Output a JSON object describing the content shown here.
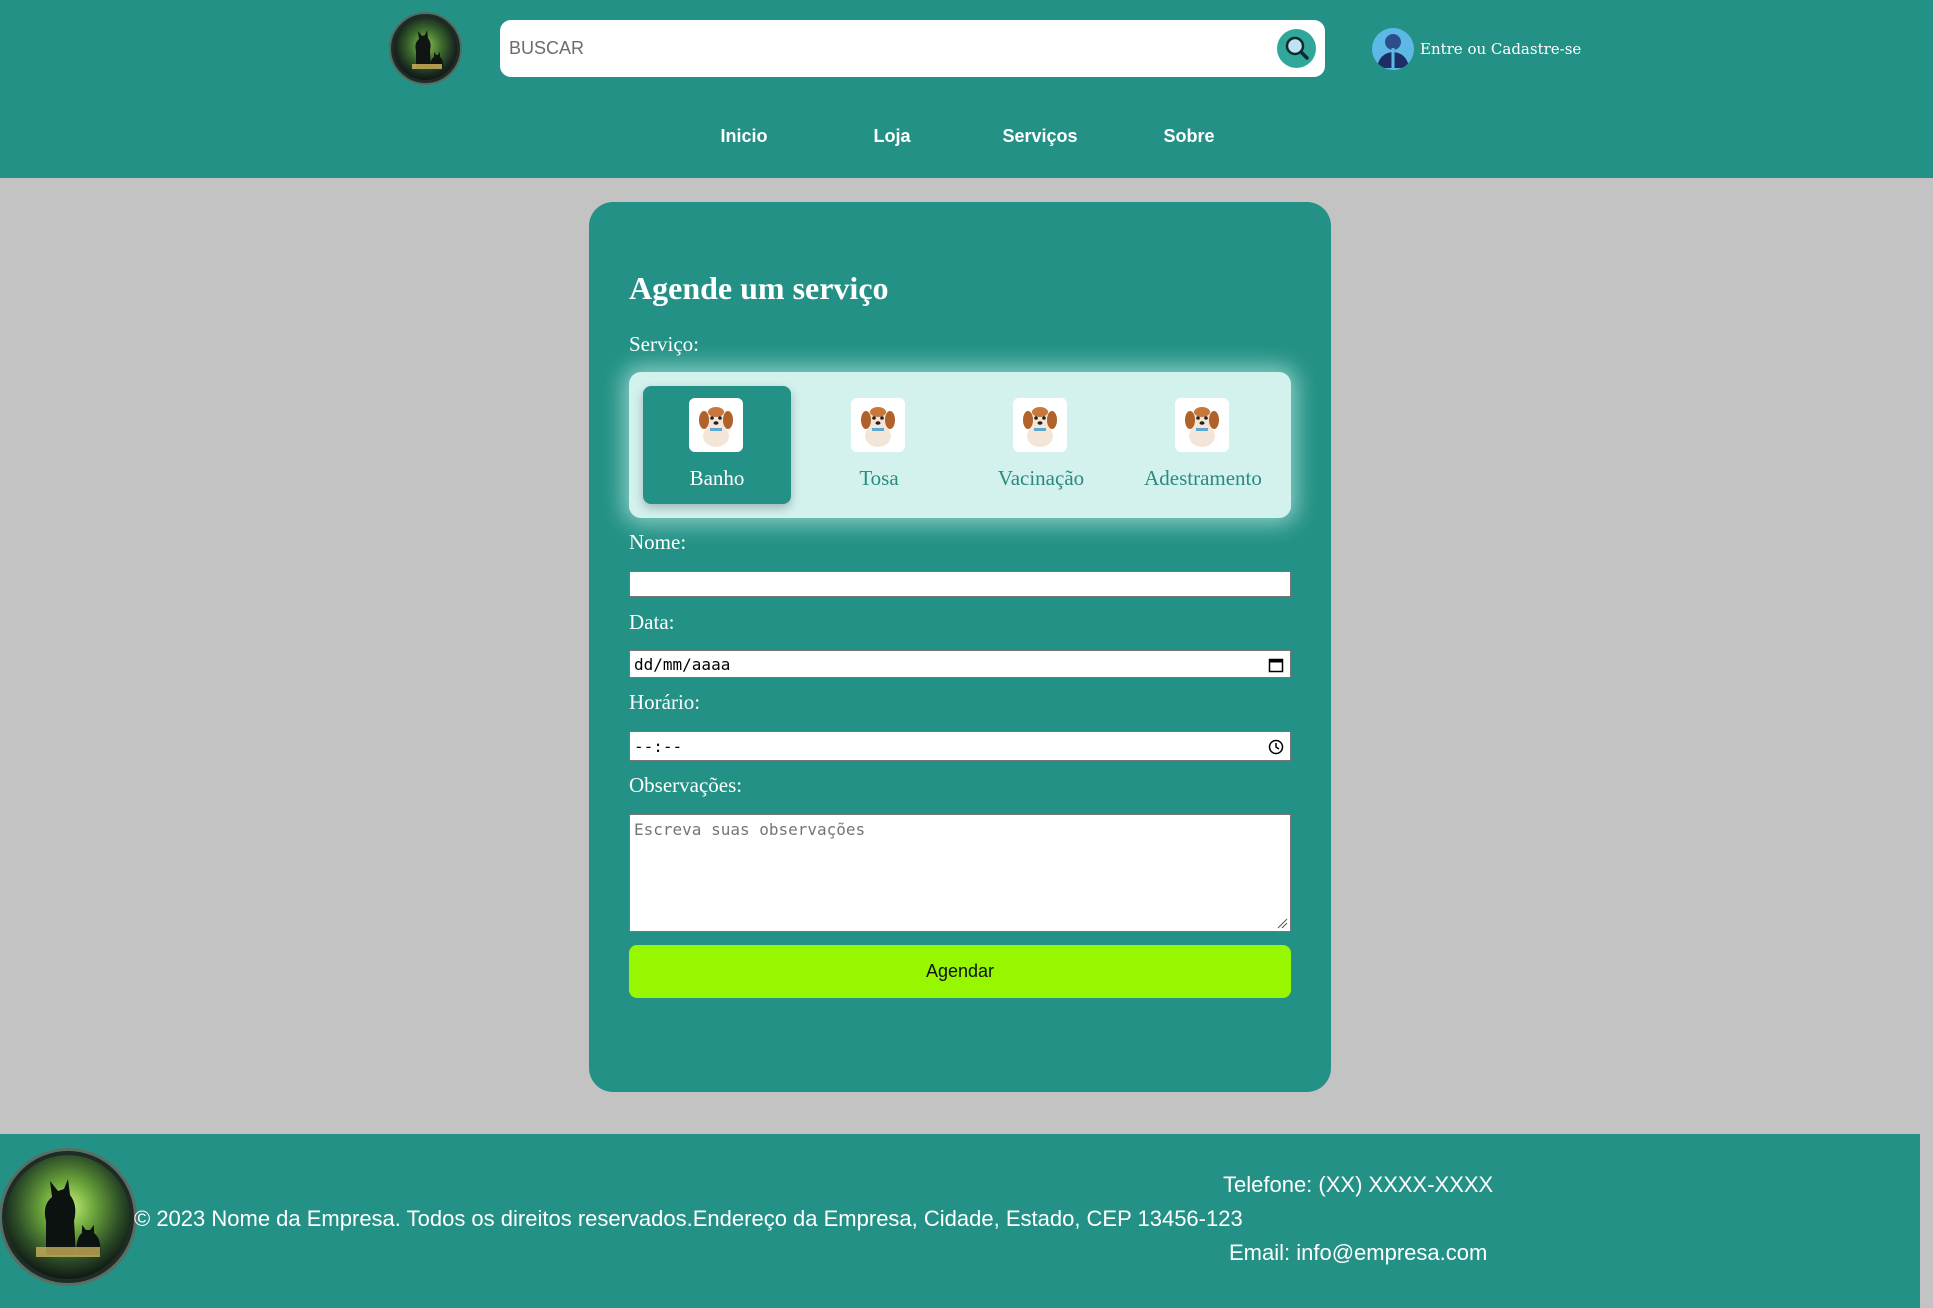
{
  "header": {
    "search": {
      "placeholder": "BUSCAR"
    },
    "login_label": "Entre ou Cadastre-se",
    "nav": [
      "Inicio",
      "Loja",
      "Serviços",
      "Sobre"
    ]
  },
  "form": {
    "title": "Agende um serviço",
    "service_label": "Serviço:",
    "services": [
      {
        "label": "Banho",
        "selected": true
      },
      {
        "label": "Tosa",
        "selected": false
      },
      {
        "label": "Vacinação",
        "selected": false
      },
      {
        "label": "Adestramento",
        "selected": false
      }
    ],
    "name_label": "Nome:",
    "name_value": "",
    "date_label": "Data:",
    "date_value": "dd/mm/aaaa",
    "time_label": "Horário:",
    "time_value": "--:--",
    "notes_label": "Observações:",
    "notes_placeholder": "Escreva suas observações",
    "submit_label": "Agendar"
  },
  "footer": {
    "phone": "Telefone: (XX) XXXX-XXXX",
    "copyright": "© 2023 Nome da Empresa. Todos os direitos reservados.Endereço da Empresa, Cidade, Estado, CEP 13456-123",
    "email": "Email: info@empresa.com"
  },
  "colors": {
    "brand": "#249186",
    "background": "#c3c3c3",
    "service_panel": "#d3f2ee",
    "submit": "#96f700"
  }
}
